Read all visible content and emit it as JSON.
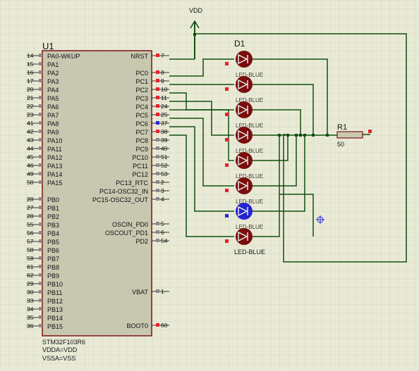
{
  "colors": {
    "background": "#e9ead6",
    "grid": "#d7d8c2",
    "chip_fill": "#c8c8b1",
    "chip_border": "#7a1515",
    "wire": "#0f4f10",
    "led_off": "#7a0d0d",
    "led_on": "#2424d0",
    "pin_red": "#e8222a",
    "pin_blue": "#2a2ad8",
    "pin_gray": "#8a8a8a",
    "resistor_fill": "#c8c8b1"
  },
  "power": {
    "label": "VDD"
  },
  "mcu": {
    "ref": "U1",
    "part": "STM32F103R6",
    "supply_1": "VDDA=VDD",
    "supply_2": "VSSA=VSS",
    "left_pins": [
      {
        "num": "14",
        "name": "PA0-WKUP"
      },
      {
        "num": "15",
        "name": "PA1"
      },
      {
        "num": "16",
        "name": "PA2"
      },
      {
        "num": "17",
        "name": "PA3"
      },
      {
        "num": "20",
        "name": "PA4"
      },
      {
        "num": "21",
        "name": "PA5"
      },
      {
        "num": "22",
        "name": "PA6"
      },
      {
        "num": "23",
        "name": "PA7"
      },
      {
        "num": "41",
        "name": "PA8"
      },
      {
        "num": "42",
        "name": "PA9"
      },
      {
        "num": "43",
        "name": "PA10"
      },
      {
        "num": "44",
        "name": "PA11"
      },
      {
        "num": "45",
        "name": "PA12"
      },
      {
        "num": "46",
        "name": "PA13"
      },
      {
        "num": "49",
        "name": "PA14"
      },
      {
        "num": "50",
        "name": "PA15"
      },
      {
        "num": "28",
        "name": "PB0"
      },
      {
        "num": "27",
        "name": "PB1"
      },
      {
        "num": "28",
        "name": "PB2"
      },
      {
        "num": "55",
        "name": "PB3"
      },
      {
        "num": "56",
        "name": "PB4"
      },
      {
        "num": "57",
        "name": "PB5"
      },
      {
        "num": "58",
        "name": "PB6"
      },
      {
        "num": "59",
        "name": "PB7"
      },
      {
        "num": "61",
        "name": "PB8"
      },
      {
        "num": "62",
        "name": "PB9"
      },
      {
        "num": "29",
        "name": "PB10"
      },
      {
        "num": "30",
        "name": "PB11"
      },
      {
        "num": "33",
        "name": "PB12"
      },
      {
        "num": "34",
        "name": "PB13"
      },
      {
        "num": "35",
        "name": "PB14"
      },
      {
        "num": "36",
        "name": "PB15"
      }
    ],
    "right_pins_top": [
      {
        "num": "7",
        "name": "NRST",
        "state": "red"
      },
      {
        "num": "8",
        "name": "PC0",
        "state": "red"
      },
      {
        "num": "9",
        "name": "PC1",
        "state": "red"
      },
      {
        "num": "10",
        "name": "PC2",
        "state": "red"
      },
      {
        "num": "11",
        "name": "PC3",
        "state": "red"
      },
      {
        "num": "24",
        "name": "PC4",
        "state": "red"
      },
      {
        "num": "25",
        "name": "PC5",
        "state": "red"
      },
      {
        "num": "37",
        "name": "PC6",
        "state": "blue"
      },
      {
        "num": "38",
        "name": "PC7",
        "state": "red"
      },
      {
        "num": "39",
        "name": "PC8",
        "state": "gray"
      },
      {
        "num": "40",
        "name": "PC9",
        "state": "gray"
      },
      {
        "num": "51",
        "name": "PC10",
        "state": "gray"
      },
      {
        "num": "52",
        "name": "PC11",
        "state": "gray"
      },
      {
        "num": "53",
        "name": "PC12",
        "state": "gray"
      },
      {
        "num": "2",
        "name": "PC13_RTC",
        "state": "gray"
      },
      {
        "num": "3",
        "name": "PC14-OSC32_IN",
        "state": "gray"
      },
      {
        "num": "4",
        "name": "PC15-OSC32_OUT",
        "state": "gray"
      }
    ],
    "right_pins_mid": [
      {
        "num": "5",
        "name": "OSCIN_PD0",
        "state": "gray"
      },
      {
        "num": "6",
        "name": "OSCOUT_PD1",
        "state": "gray"
      },
      {
        "num": "54",
        "name": "PD2",
        "state": "gray"
      }
    ],
    "vbat": {
      "num": "1",
      "name": "VBAT"
    },
    "boot0": {
      "num": "60",
      "name": "BOOT0"
    }
  },
  "leds": {
    "ref": "D1",
    "value": "LED-BLUE",
    "count": 8,
    "lit": [
      false,
      false,
      false,
      false,
      false,
      false,
      true,
      false
    ]
  },
  "resistor": {
    "ref": "R1",
    "value": "50"
  }
}
